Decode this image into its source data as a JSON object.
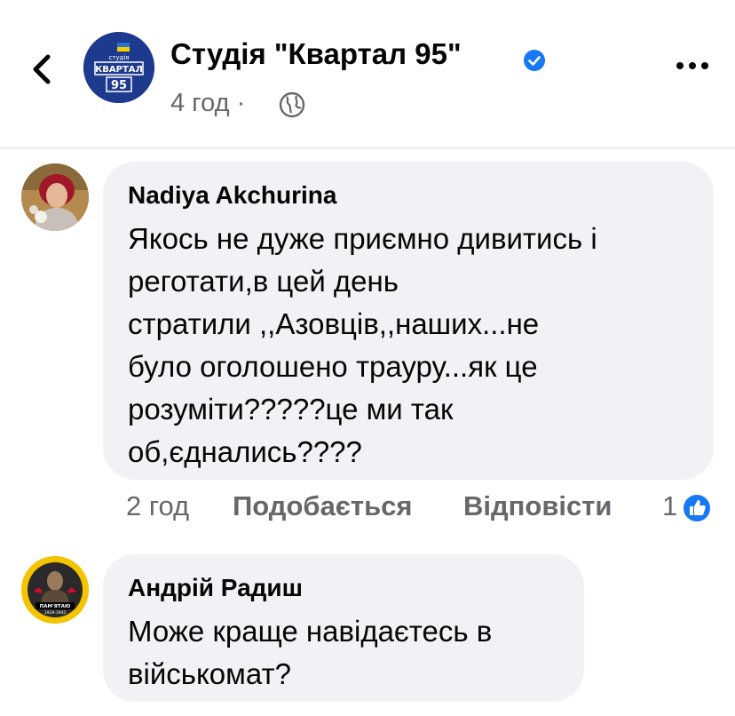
{
  "header": {
    "page_name": "Студія \"Квартал 95\"",
    "post_time": "4 год",
    "separator": "·",
    "logo_text_top": "студія",
    "logo_text_mid": "КВАРТАЛ",
    "logo_text_num": "95",
    "icons": [
      "back-chevron-icon",
      "verified-badge-icon",
      "globe-icon",
      "more-icon"
    ]
  },
  "comments": [
    {
      "author": "Nadiya Akchurina",
      "lines": [
        "Якось не дуже приємно дивитись і",
        "реготати,в цей день",
        "стратили ,,Азовців,,наших...не",
        "було оголошено трауру...як це",
        "розуміти?????це ми так",
        "об,єднались????"
      ],
      "time": "2 год",
      "like_label": "Подобається",
      "reply_label": "Відповісти",
      "reaction_count": "1"
    },
    {
      "author": "Андрій Радиш",
      "lines": [
        "Може краще навідаєтесь в",
        "військомат?"
      ],
      "avatar_text": "ПАМ'ЯТАЮ",
      "avatar_years": "1929-1945"
    }
  ],
  "colors": {
    "facebook_blue": "#1877f2",
    "bubble_bg": "#f0f2f5",
    "secondary_text": "#65676b"
  }
}
